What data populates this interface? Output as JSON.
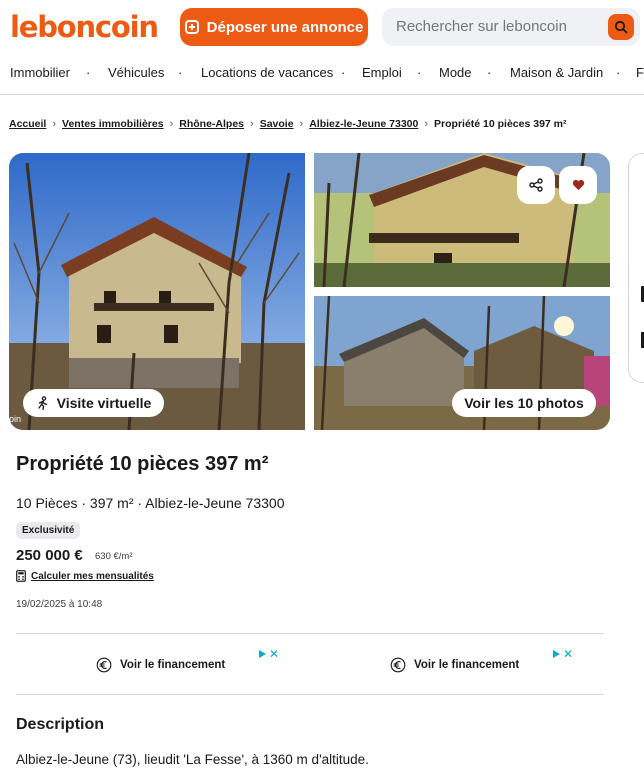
{
  "header": {
    "logo": "leboncoin",
    "post_button": "Déposer une annonce",
    "search_placeholder": "Rechercher sur leboncoin"
  },
  "nav": {
    "items": [
      "Immobilier",
      "Véhicules",
      "Locations de vacances",
      "Emploi",
      "Mode",
      "Maison & Jardin",
      "Fa"
    ],
    "separator": "·"
  },
  "breadcrumb": {
    "links": [
      "Accueil",
      "Ventes immobilières",
      "Rhône-Alpes",
      "Savoie",
      "Albiez-le-Jeune 73300"
    ],
    "current": "Propriété 10 pièces 397 m²",
    "separator": "›"
  },
  "gallery": {
    "virtual_tour": "Visite virtuelle",
    "view_photos": "Voir les 10 photos",
    "credit": "oin",
    "share_icon": "share-icon",
    "favorite_icon": "heart-icon"
  },
  "listing": {
    "title": "Propriété 10 pièces 397 m²",
    "subtitle": "10 Pièces · 397 m² · Albiez-le-Jeune 73300",
    "badge": "Exclusivité",
    "price": "250 000 €",
    "price_per_m2": "630 €/m²",
    "calculator": "Calculer mes mensualités",
    "date": "19/02/2025 à 10:48"
  },
  "ads": [
    {
      "label": "Voir le financement",
      "close": "✕"
    },
    {
      "label": "Voir le financement",
      "close": "✕"
    }
  ],
  "description": {
    "heading": "Description",
    "text": "Albiez-le-Jeune (73), lieudit 'La Fesse', à 1360 m d'altitude."
  },
  "colors": {
    "brand": "#ec5a13",
    "favorite": "#9a2a1e",
    "ad_accent": "#00aecd"
  }
}
